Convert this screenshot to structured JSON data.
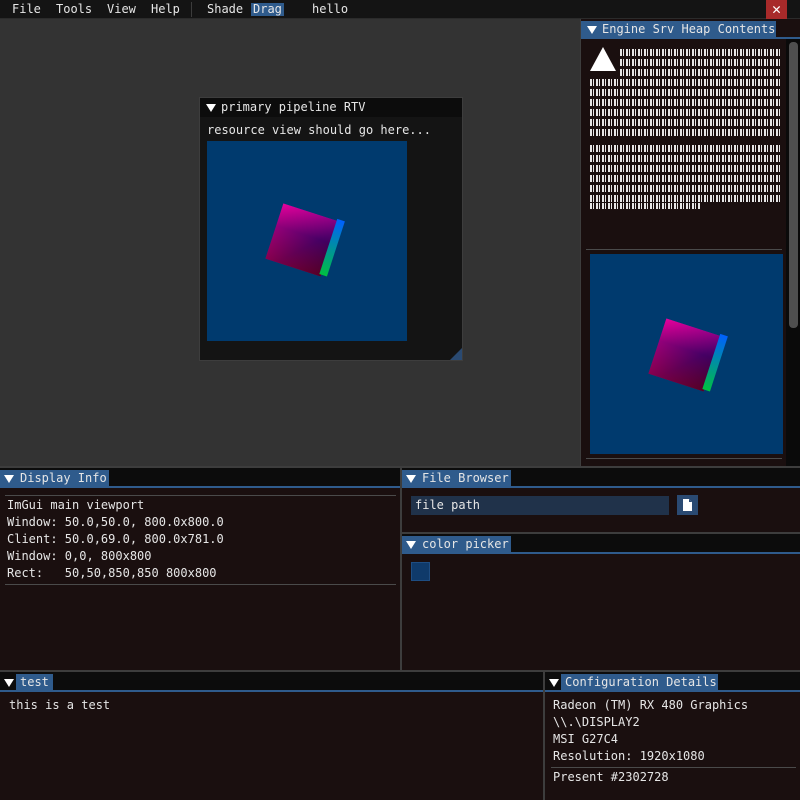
{
  "menu": {
    "file": "File",
    "tools": "Tools",
    "view": "View",
    "help": "Help",
    "shade": "Shade",
    "drag": "Drag",
    "hello": "hello",
    "close_glyph": "✕"
  },
  "rtv_window": {
    "title": "primary pipeline RTV",
    "text": "resource view should go here..."
  },
  "heap_panel": {
    "title": "Engine Srv Heap Contents"
  },
  "display_info": {
    "title": "Display Info",
    "lines": [
      "ImGui main viewport",
      "Window: 50.0,50.0, 800.0x800.0",
      "Client: 50.0,69.0, 800.0x781.0",
      "Window: 0,0, 800x800",
      "Rect:   50,50,850,850 800x800"
    ]
  },
  "file_browser": {
    "title": "File Browser",
    "input_value": "file path",
    "button_icon": "file-icon"
  },
  "color_picker": {
    "title": "color picker",
    "color": "#0f3a6a"
  },
  "test_panel": {
    "title": "test",
    "text": "this is a test"
  },
  "config_details": {
    "title": "Configuration Details",
    "gpu": "Radeon (TM) RX 480 Graphics",
    "display": "\\\\.\\DISPLAY2",
    "monitor": "MSI G27C4",
    "resolution": "Resolution: 1920x1080",
    "present": "Present #2302728"
  },
  "colors": {
    "accent": "#2f5b8c",
    "panel_bg": "#1a0f0f",
    "viewport_bg": "#333333",
    "image_bg": "#003a6e",
    "close_red": "#a82a2a"
  }
}
